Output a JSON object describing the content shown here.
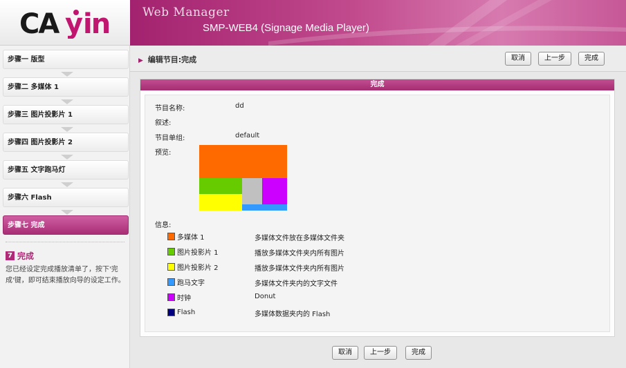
{
  "brand": {
    "logo_text": "cayin",
    "app_title": "Web Manager",
    "app_subtitle": "SMP-WEB4 (Signage Media Player)",
    "accent_color": "#a3226f"
  },
  "sidebar": {
    "steps": [
      {
        "label": "步骤一 版型"
      },
      {
        "label": "步骤二 多媒体 1"
      },
      {
        "label": "步骤三 图片投影片 1"
      },
      {
        "label": "步骤四 图片投影片 2"
      },
      {
        "label": "步骤五 文字跑马灯"
      },
      {
        "label": "步骤六 Flash"
      },
      {
        "label": "步骤七 完成"
      }
    ],
    "info_number": "7",
    "info_title": "完成",
    "info_text": "您已经设定完成播放清单了，按下'完成'键，即可结束播放向导的设定工作。"
  },
  "toolbar": {
    "breadcrumb": "编辑节目:完成",
    "cancel_label": "取消",
    "prev_label": "上一步",
    "finish_label": "完成"
  },
  "panel": {
    "title": "完成",
    "name_label": "节目名称:",
    "name_value": "dd",
    "desc_label": "叙述:",
    "group_label": "节目单组:",
    "group_value": "default",
    "preview_label": "预览:",
    "info_label": "信息:"
  },
  "legend": [
    {
      "name": "多媒体 1",
      "color": "#ff6a00",
      "desc": "多媒体文件放在多媒体文件夹"
    },
    {
      "name": "图片投影片 1",
      "color": "#66cc00",
      "desc": "播放多媒体文件夹内所有图片"
    },
    {
      "name": "图片投影片 2",
      "color": "#ffff00",
      "desc": "播放多媒体文件夹内所有图片"
    },
    {
      "name": "跑马文字",
      "color": "#3399ff",
      "desc": "多媒体文件夹内的文字文件"
    },
    {
      "name": "时钟",
      "color": "#cc00ff",
      "desc": "Donut"
    },
    {
      "name": "Flash",
      "color": "#000080",
      "desc": "多媒体数据夹内的 Flash"
    }
  ],
  "preview_colors": {
    "multimedia": "#ff6a00",
    "slide1": "#66cc00",
    "slide2": "#ffff00",
    "ticker": "#3399ff",
    "clock": "#cc00ff",
    "empty": "#c0c0c0"
  },
  "bottom": {
    "cancel_label": "取消",
    "prev_label": "上一步",
    "finish_label": "完成"
  }
}
